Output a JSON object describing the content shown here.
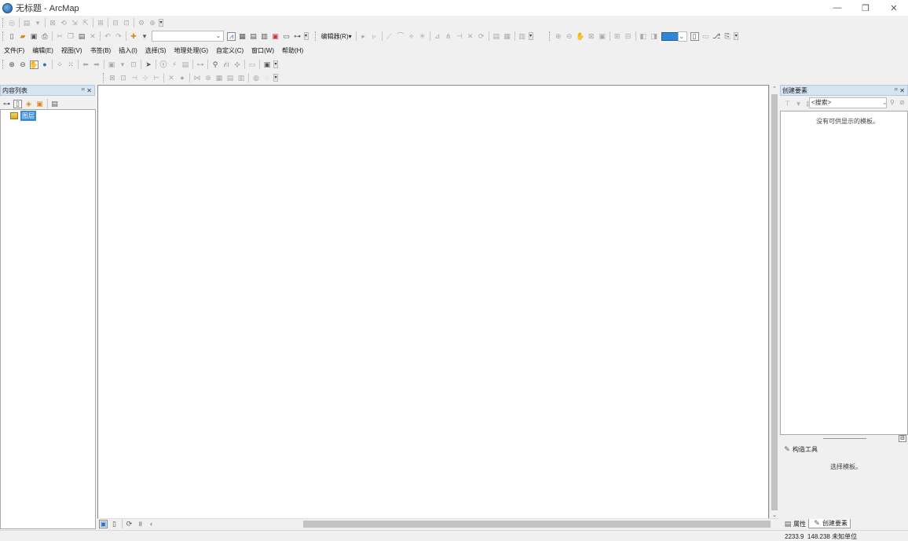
{
  "window": {
    "title": "无标题 - ArcMap",
    "minimize": "—",
    "restore": "❐",
    "close": "✕"
  },
  "menu": [
    "文件(F)",
    "编辑(E)",
    "视图(V)",
    "书签(B)",
    "插入(I)",
    "选择(S)",
    "地理处理(G)",
    "自定义(C)",
    "窗口(W)",
    "帮助(H)"
  ],
  "editor_toolbar": {
    "label": "编辑器(R)▾"
  },
  "toc": {
    "title": "内容列表",
    "pin": "ꟸ ✕",
    "layer_root": "图层"
  },
  "create_features": {
    "title": "创建要素",
    "pin": "ꟸ ✕",
    "search_placeholder": "<搜索>",
    "no_templates": "没有可供显示的模板。",
    "construction_title": "构造工具",
    "select_template": "选择模板。"
  },
  "bottom_tabs": {
    "attributes": "属性",
    "create_features": "创建要素"
  },
  "status": {
    "x": "2233.9",
    "y": "148.238",
    "units": "未知单位"
  },
  "colors": {
    "accent": "#3a8ed6",
    "panel_header": "#d7e4f2"
  }
}
